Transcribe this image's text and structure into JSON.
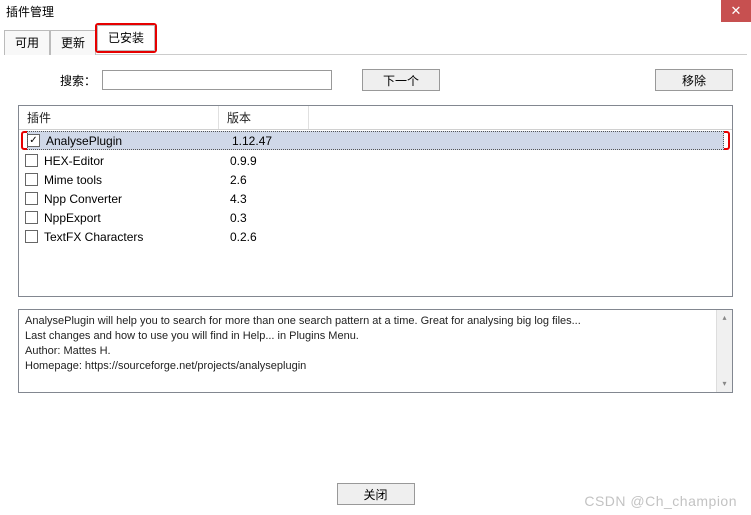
{
  "window": {
    "title": "插件管理",
    "close_glyph": "✕"
  },
  "tabs": {
    "available": "可用",
    "update": "更新",
    "installed": "已安装"
  },
  "search": {
    "label": "搜索：",
    "value": "",
    "next": "下一个",
    "remove": "移除"
  },
  "columns": {
    "plugin": "插件",
    "version": "版本"
  },
  "plugins": [
    {
      "name": "AnalysePlugin",
      "version": "1.12.47",
      "checked": true,
      "selected": true
    },
    {
      "name": "HEX-Editor",
      "version": "0.9.9",
      "checked": false,
      "selected": false
    },
    {
      "name": "Mime tools",
      "version": "2.6",
      "checked": false,
      "selected": false
    },
    {
      "name": "Npp Converter",
      "version": "4.3",
      "checked": false,
      "selected": false
    },
    {
      "name": "NppExport",
      "version": "0.3",
      "checked": false,
      "selected": false
    },
    {
      "name": "TextFX Characters",
      "version": "0.2.6",
      "checked": false,
      "selected": false
    }
  ],
  "description": {
    "line1": "AnalysePlugin will help you to search for more than one search pattern at a time. Great for analysing big log files...",
    "line2": "Last changes and how to use you will find in Help... in Plugins Menu.",
    "line3": "Author: Mattes H.",
    "line4": "Homepage: https://sourceforge.net/projects/analyseplugin"
  },
  "buttons": {
    "close": "关闭"
  },
  "watermark": "CSDN @Ch_champion",
  "scroll": {
    "up": "▴",
    "down": "▾"
  },
  "check_glyph": "✓"
}
